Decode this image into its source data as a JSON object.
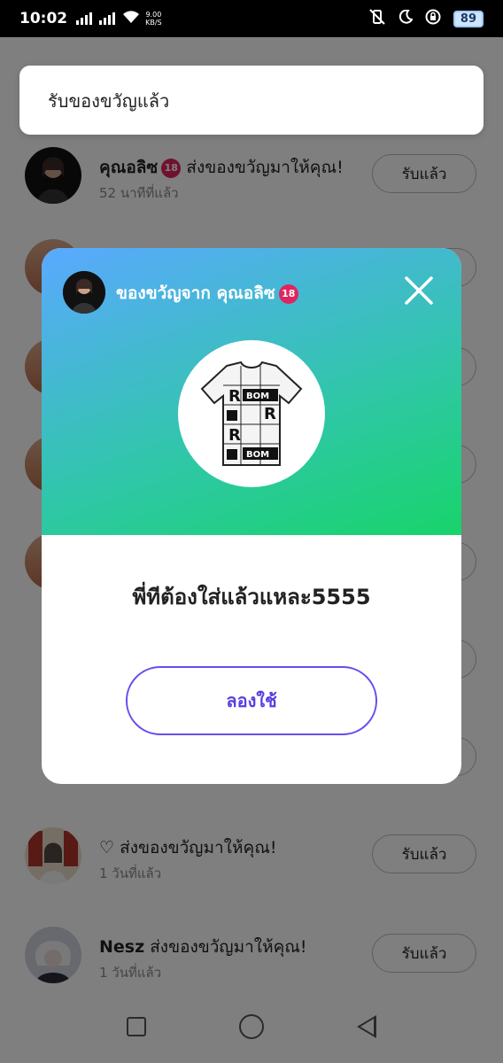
{
  "status_bar": {
    "time": "10:02",
    "net_speed_value": "9.00",
    "net_speed_unit": "KB/S",
    "battery": "89"
  },
  "top_card": {
    "label": "รับของขวัญแล้ว"
  },
  "list": [
    {
      "name": "คุณอลิซ",
      "badge": "18",
      "message": "ส่งของขวัญมาให้คุณ!",
      "time": "52 นาทีที่แล้ว",
      "button": "รับแล้ว"
    },
    {
      "name": "♡",
      "message": "ส่งของขวัญมาให้คุณ!",
      "time": "1 วันที่แล้ว",
      "button": "รับแล้ว"
    },
    {
      "name": "Nesz",
      "message": "ส่งของขวัญมาให้คุณ!",
      "time": "1 วันที่แล้ว",
      "button": "รับแล้ว"
    }
  ],
  "modal": {
    "title": "ของขวัญจาก คุณอลิซ",
    "badge": "18",
    "gift_message": "พี่ทีต้องใส่แล้วแหละ5555",
    "try_button": "ลองใช้",
    "gift_print": "BOM",
    "gradient_colors": [
      "#5aa9ff",
      "#18d46a"
    ]
  }
}
